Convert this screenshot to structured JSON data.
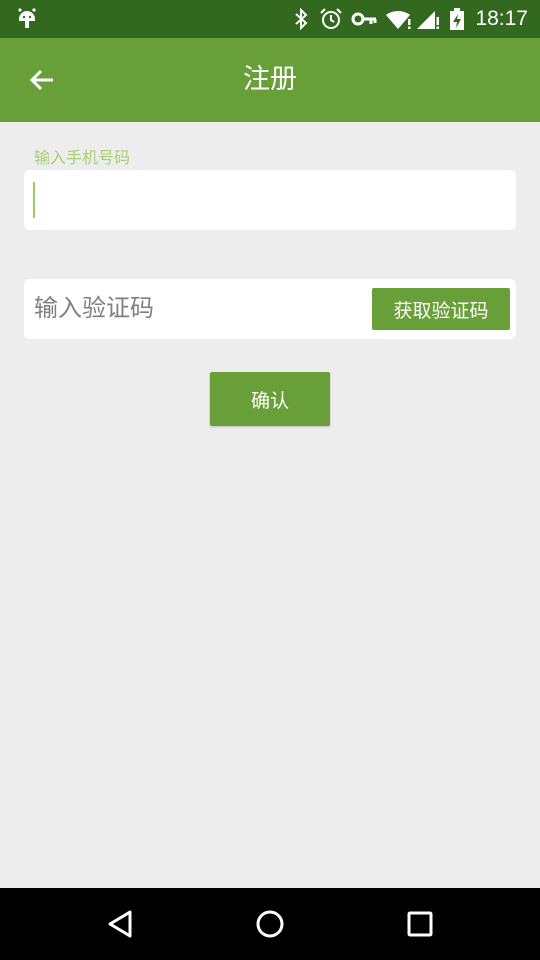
{
  "status_bar": {
    "time": "18:17",
    "icons": [
      "android-debug-icon",
      "bluetooth-icon",
      "alarm-icon",
      "vpn-key-icon",
      "wifi-icon",
      "signal-icon",
      "battery-charging-icon"
    ],
    "bar_color": "#33691e"
  },
  "app_bar": {
    "title": "注册",
    "back_icon": "arrow-left-icon",
    "bar_color": "#689f38"
  },
  "form": {
    "phone_label": "输入手机号码",
    "phone_value": "",
    "code_placeholder": "输入验证码",
    "code_value": "",
    "get_code_label": "获取验证码",
    "confirm_label": "确认",
    "accent_color": "#689f38"
  },
  "nav_bar": {
    "icons": [
      "back-triangle-icon",
      "home-circle-icon",
      "recents-square-icon"
    ]
  }
}
